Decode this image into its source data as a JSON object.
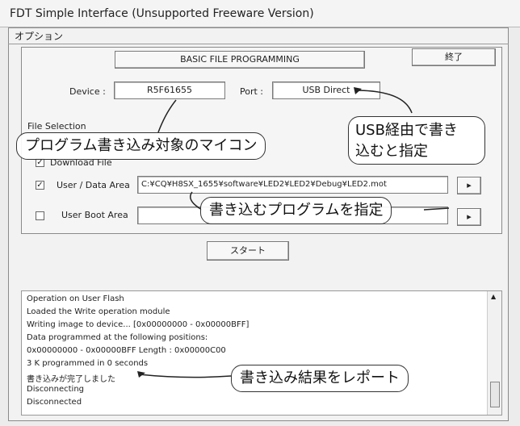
{
  "window": {
    "title": "FDT Simple Interface  (Unsupported Freeware Version)"
  },
  "menu": {
    "options": "オプション"
  },
  "header": {
    "mode": "BASIC FILE PROGRAMMING",
    "exit_label": "終了"
  },
  "device": {
    "label": "Device :",
    "value": "R5F61655"
  },
  "port": {
    "label": "Port :",
    "value": "USB Direct"
  },
  "file_selection": {
    "label": "File Selection",
    "download_label": "Download File",
    "user_data": {
      "label": "User / Data Area",
      "checked": true,
      "path": "C:¥CQ¥H8SX_1655¥software¥LED2¥LED2¥Debug¥LED2.mot",
      "browse": "▸"
    },
    "user_boot": {
      "label": "User Boot Area",
      "checked": false,
      "path": "",
      "browse": "▸"
    }
  },
  "start_label": "スタート",
  "log": {
    "lines": [
      "Operation on User Flash",
      "Loaded the Write operation module",
      "Writing image to device... [0x00000000 - 0x00000BFF]",
      "Data programmed at the following positions:",
      " 0x00000000 - 0x00000BFF       Length : 0x00000C00",
      "3 K programmed in 0 seconds",
      "書き込みが完了しました",
      "Disconnecting",
      "Disconnected"
    ]
  },
  "annotations": {
    "device_note": "プログラム書き込み対象のマイコン",
    "port_note_line1": "USB経由で書き",
    "port_note_line2": "込むと指定",
    "file_note": "書き込むプログラムを指定",
    "log_note": "書き込み結果をレポート"
  }
}
